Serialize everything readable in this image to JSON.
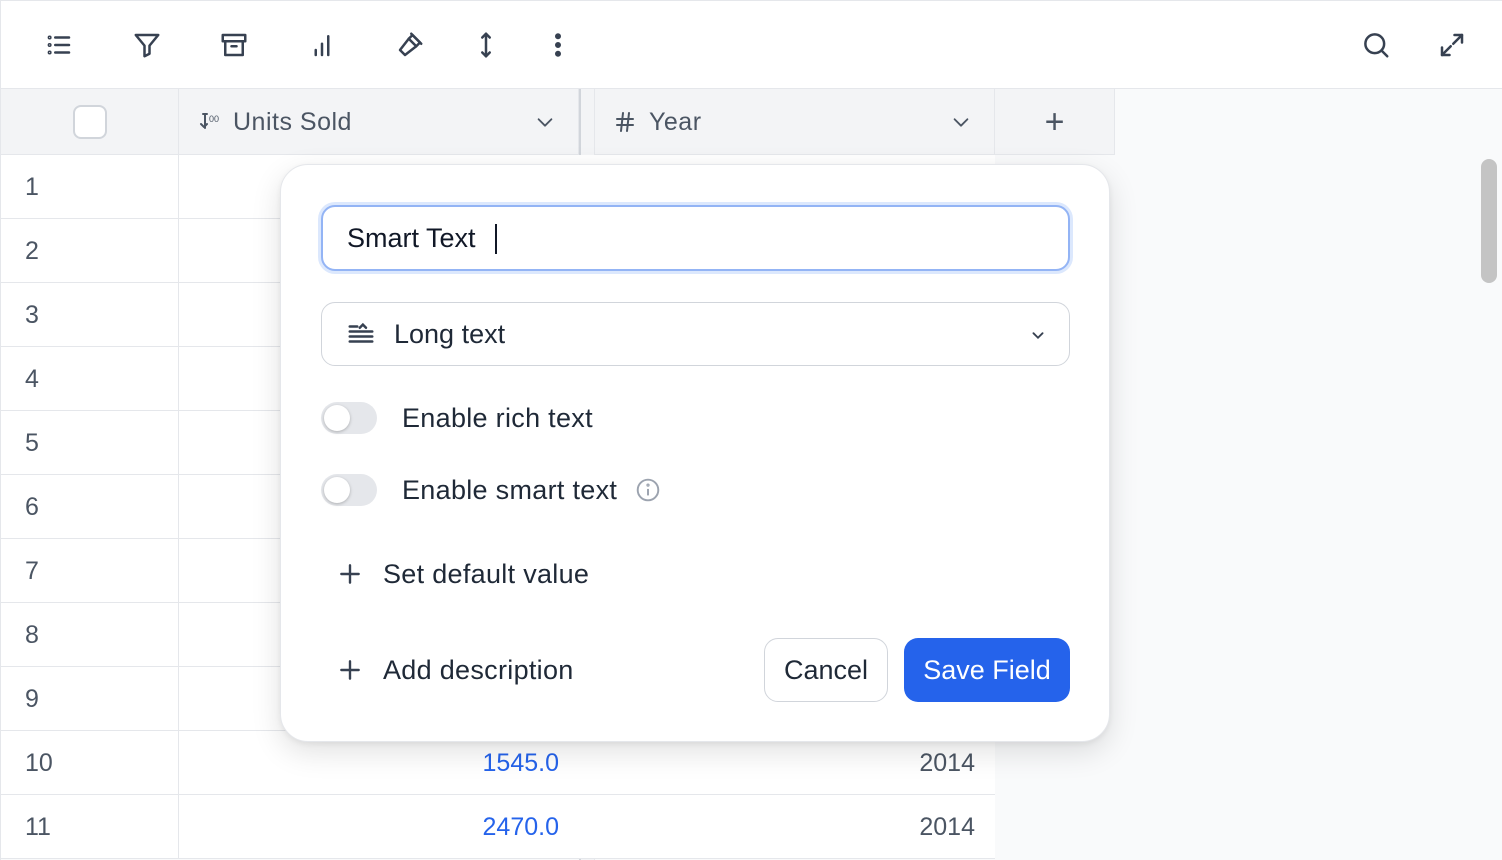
{
  "toolbar": {
    "left_icons": [
      "list-icon",
      "filter-icon",
      "archive-icon",
      "bar-chart-icon",
      "hammer-icon",
      "row-height-icon",
      "more-vertical-icon"
    ],
    "right_icons": [
      "search-icon",
      "expand-icon"
    ]
  },
  "columns": [
    {
      "label": "Units Sold",
      "icon": "formula-number-icon"
    },
    {
      "label": "Year",
      "icon": "hash-icon"
    }
  ],
  "add_column_label": "+",
  "rows": [
    {
      "num": "1",
      "units": "",
      "year": ""
    },
    {
      "num": "2",
      "units": "",
      "year": ""
    },
    {
      "num": "3",
      "units": "",
      "year": ""
    },
    {
      "num": "4",
      "units": "",
      "year": ""
    },
    {
      "num": "5",
      "units": "",
      "year": ""
    },
    {
      "num": "6",
      "units": "",
      "year": ""
    },
    {
      "num": "7",
      "units": "",
      "year": ""
    },
    {
      "num": "8",
      "units": "",
      "year": ""
    },
    {
      "num": "9",
      "units": "",
      "year": ""
    },
    {
      "num": "10",
      "units": "1545.0",
      "year": "2014"
    },
    {
      "num": "11",
      "units": "2470.0",
      "year": "2014"
    }
  ],
  "dialog": {
    "field_name": "Smart Text",
    "field_type": "Long text",
    "toggles": [
      {
        "label": "Enable rich text",
        "on": false
      },
      {
        "label": "Enable smart text",
        "on": false
      }
    ],
    "set_default_label": "Set default value",
    "add_description_label": "Add description",
    "cancel_label": "Cancel",
    "save_label": "Save Field"
  },
  "colors": {
    "accent": "#2563eb",
    "link_number": "#2563eb"
  }
}
